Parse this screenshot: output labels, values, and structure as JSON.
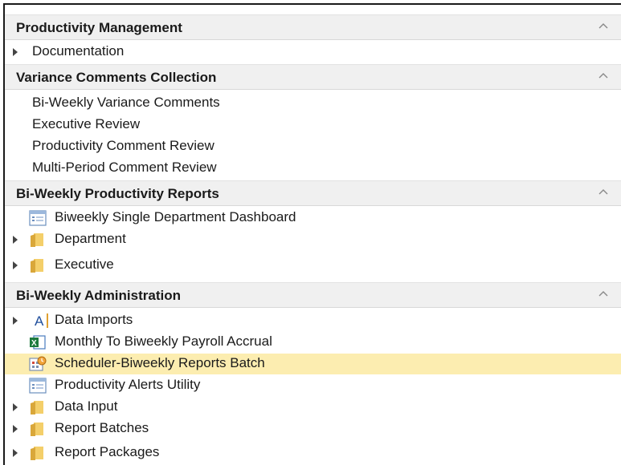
{
  "sections": [
    {
      "title": "Productivity Management",
      "items": [
        {
          "label": "Documentation",
          "expandable": true,
          "icon": "none"
        }
      ]
    },
    {
      "title": "Variance Comments Collection",
      "items": [
        {
          "label": "Bi-Weekly Variance Comments",
          "expandable": false,
          "icon": "none"
        },
        {
          "label": "Executive Review",
          "expandable": false,
          "icon": "none"
        },
        {
          "label": "Productivity Comment Review",
          "expandable": false,
          "icon": "none"
        },
        {
          "label": "Multi-Period Comment Review",
          "expandable": false,
          "icon": "none"
        }
      ]
    },
    {
      "title": "Bi-Weekly Productivity Reports",
      "items": [
        {
          "label": "Biweekly Single Department Dashboard",
          "expandable": false,
          "icon": "report-icon"
        },
        {
          "label": "Department",
          "expandable": true,
          "icon": "folder-icon"
        },
        {
          "label": "Executive",
          "expandable": true,
          "icon": "folder-icon"
        }
      ]
    },
    {
      "title": "Bi-Weekly Administration",
      "items": [
        {
          "label": "Data Imports",
          "expandable": true,
          "icon": "text-a-icon"
        },
        {
          "label": "Monthly To Biweekly Payroll Accrual",
          "expandable": false,
          "icon": "excel-icon"
        },
        {
          "label": "Scheduler-Biweekly Reports Batch",
          "expandable": false,
          "icon": "scheduler-icon",
          "selected": true
        },
        {
          "label": "Productivity Alerts Utility",
          "expandable": false,
          "icon": "report-icon"
        },
        {
          "label": "Data Input",
          "expandable": true,
          "icon": "folder-icon"
        },
        {
          "label": "Report Batches",
          "expandable": true,
          "icon": "folder-icon"
        },
        {
          "label": "Report Packages",
          "expandable": true,
          "icon": "folder-icon"
        }
      ]
    }
  ],
  "colors": {
    "header_bg": "#f0f0f0",
    "selected_bg": "#fcedb0",
    "folder": "#e8b84a"
  }
}
